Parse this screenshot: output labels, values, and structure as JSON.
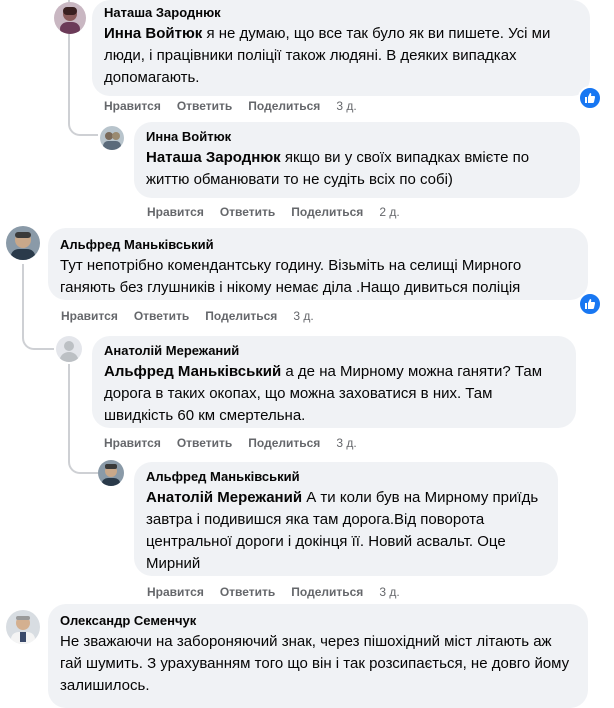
{
  "actions": {
    "like": "Нравится",
    "reply": "Ответить",
    "share": "Поделиться"
  },
  "comments": [
    {
      "author": "Наташа Зароднюк",
      "tag": "Инна Войтюк",
      "text": " я не думаю, що все так було як ви пишете. Усі ми люди, і працівники поліції також людяні. В деяких випадках допомагають.",
      "time": "3 д."
    },
    {
      "author": "Инна Войтюк",
      "tag": "Наташа Зароднюк",
      "text": " якщо ви у своїх випадках вмієте по життю обманювати то не судіть всіх по собі)",
      "time": "2 д."
    },
    {
      "author": "Альфред Маньківський",
      "tag": "",
      "text": "Тут непотрібно комендантську годину. Візьміть на селищі Мирного ганяють без глушників і нікому немає діла .Нащо дивиться поліція",
      "time": "3 д."
    },
    {
      "author": "Анатолій Мережаний",
      "tag": "Альфред Маньківський",
      "text": " а де на Мирному можна ганяти? Там дорога в таких окопах, що можна заховатися в них. Там швидкість 60 км смертельна.",
      "time": "3 д."
    },
    {
      "author": "Альфред Маньківський",
      "tag": "Анатолій Мережаний",
      "text": " А ти коли був на Мирному приїдь завтра і подивишся яка там дорога.Від поворота центральної дороги і докінця її. Новий асвальт. Оце Мирний",
      "time": "3 д."
    },
    {
      "author": "Олександр Семенчук",
      "tag": "",
      "text": "Не зважаючи на забороняючий знак, через пішохідний міст літають аж гай шумить. З урахуванням того що він і так розсипається, не довго йому залишилось.",
      "time": ""
    }
  ],
  "colors": {
    "bubble": "#f0f2f5",
    "meta": "#65676b",
    "like_blue": "#1877f2",
    "thread_line": "#ced0d4"
  }
}
